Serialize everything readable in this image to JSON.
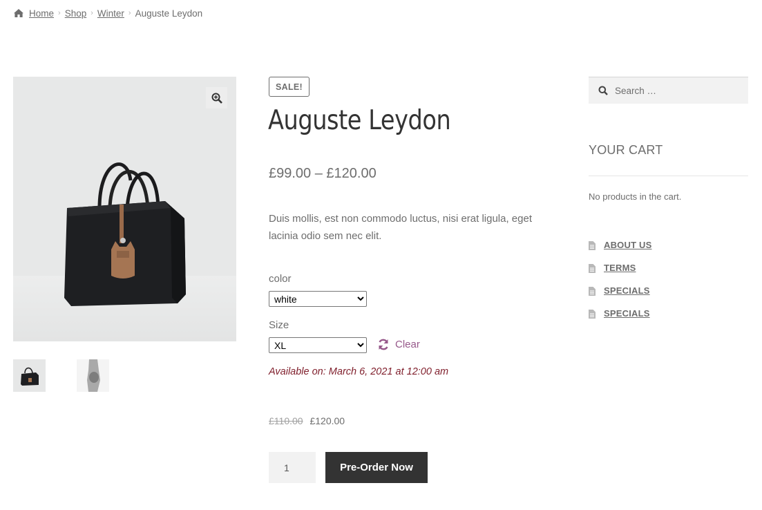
{
  "breadcrumb": {
    "items": [
      "Home",
      "Shop",
      "Winter"
    ],
    "current": "Auguste Leydon"
  },
  "product": {
    "badge": "SALE!",
    "title": "Auguste Leydon",
    "price_range": "£99.00 – £120.00",
    "description": "Duis mollis, est non commodo luctus, nisi erat ligula, eget lacinia odio sem nec elit.",
    "variations": {
      "color_label": "color",
      "color_value": "white",
      "size_label": "Size",
      "size_value": "XL",
      "clear_label": "Clear"
    },
    "availability": "Available on: March 6, 2021 at 12:00 am",
    "old_price": "£110.00",
    "new_price": "£120.00",
    "quantity": "1",
    "preorder_label": "Pre-Order Now"
  },
  "sidebar": {
    "search_placeholder": "Search …",
    "cart_title": "YOUR CART",
    "cart_empty": "No products in the cart.",
    "pages": [
      "ABOUT US",
      "TERMS",
      "SPECIALS",
      "SPECIALS"
    ]
  },
  "colors": {
    "accent": "#96588a",
    "availability": "#7f1e2b",
    "button": "#333333",
    "text": "#6d6d6d"
  },
  "icons": [
    "home-icon",
    "zoom-icon",
    "refresh-icon",
    "search-icon",
    "document-icon"
  ]
}
